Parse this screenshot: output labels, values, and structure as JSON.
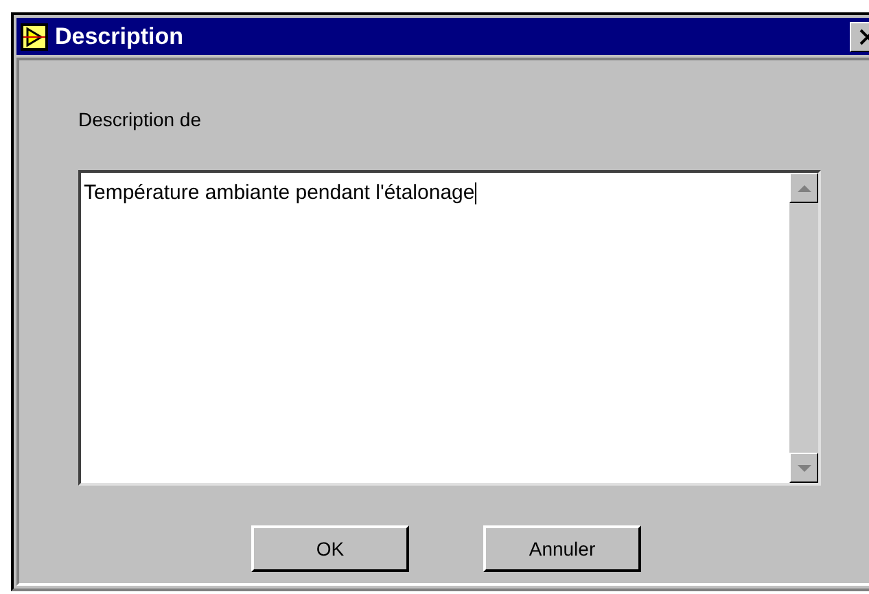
{
  "window": {
    "title": "Description"
  },
  "label": "Description de",
  "field": {
    "value": "Température ambiante pendant l'étalonage"
  },
  "buttons": [
    {
      "label": "OK"
    },
    {
      "label": "Annuler"
    }
  ]
}
